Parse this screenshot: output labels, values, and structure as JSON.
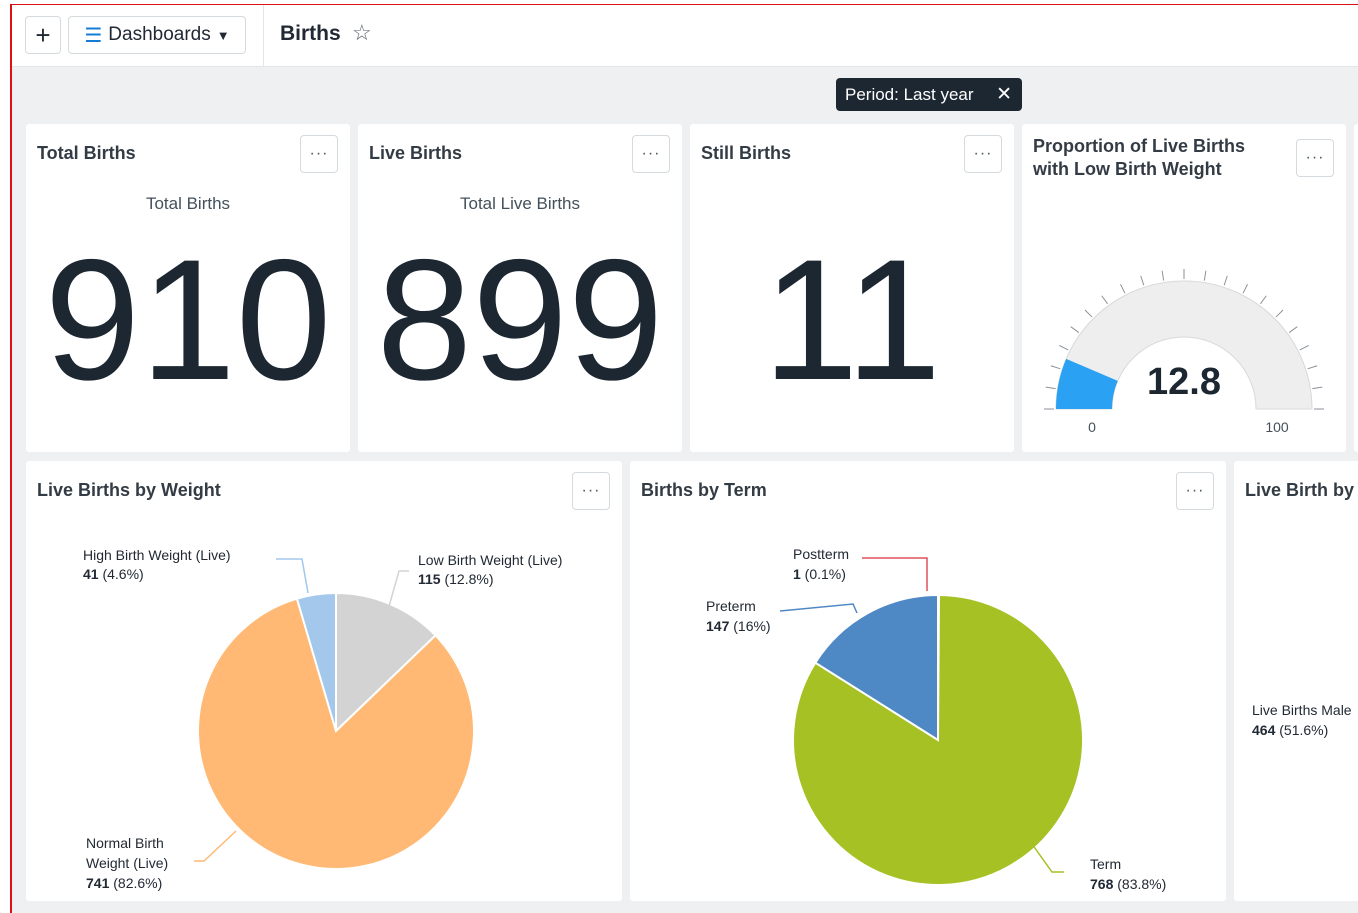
{
  "header": {
    "add_label": "+",
    "dashboards_label": "Dashboards",
    "title": "Births"
  },
  "filter_chip": {
    "label": "Period: Last year"
  },
  "menu_label": "···",
  "kpis": [
    {
      "title": "Total Births",
      "subtitle": "Total Births",
      "value": "910"
    },
    {
      "title": "Live Births",
      "subtitle": "Total Live Births",
      "value": "899"
    },
    {
      "title": "Still Births",
      "subtitle": "",
      "value": "11"
    }
  ],
  "gauge": {
    "title_line1": "Proportion of Live Births",
    "title_line2": "with Low Birth Weight",
    "value": 12.8,
    "value_label": "12.8",
    "min_label": "0",
    "max_label": "100",
    "fill_color": "#2aa1f2"
  },
  "chart_data": [
    {
      "type": "pie",
      "title": "Live Births by Weight",
      "slices": [
        {
          "name": "Low Birth Weight (Live)",
          "value": 115,
          "pct": "12.8%",
          "color": "#d3d3d3"
        },
        {
          "name": "Normal Birth Weight (Live)",
          "value": 741,
          "pct": "82.6%",
          "color": "#ffb974"
        },
        {
          "name": "High Birth Weight (Live)",
          "value": 41,
          "pct": "4.6%",
          "color": "#a3c8ec"
        }
      ]
    },
    {
      "type": "pie",
      "title": "Births by Term",
      "slices": [
        {
          "name": "Postterm",
          "value": 1,
          "pct": "0.1%",
          "color": "#e0505a"
        },
        {
          "name": "Term",
          "value": 768,
          "pct": "83.8%",
          "color": "#a5c124"
        },
        {
          "name": "Preterm",
          "value": 147,
          "pct": "16%",
          "color": "#4e88c5"
        }
      ]
    },
    {
      "type": "pie",
      "title": "Live Birth by",
      "slices": [
        {
          "name": "Live Births Male",
          "value": 464,
          "pct": "51.6%"
        }
      ]
    }
  ],
  "pie_labels": {
    "weight": {
      "high_name": "High Birth Weight (Live)",
      "high_val": "41",
      "high_pct": " (4.6%)",
      "low_name": "Low Birth Weight (Live)",
      "low_val": "115",
      "low_pct": " (12.8%)",
      "normal_name1": "Normal Birth",
      "normal_name2": "Weight (Live)",
      "normal_val": "741",
      "normal_pct": " (82.6%)"
    },
    "term": {
      "post_name": "Postterm",
      "post_val": "1",
      "post_pct": " (0.1%)",
      "pre_name": "Preterm",
      "pre_val": "147",
      "pre_pct": " (16%)",
      "term_name": "Term",
      "term_val": "768",
      "term_pct": " (83.8%)"
    },
    "gender": {
      "male_name": "Live Births Male",
      "male_val": "464",
      "male_pct": " (51.6%)"
    }
  }
}
